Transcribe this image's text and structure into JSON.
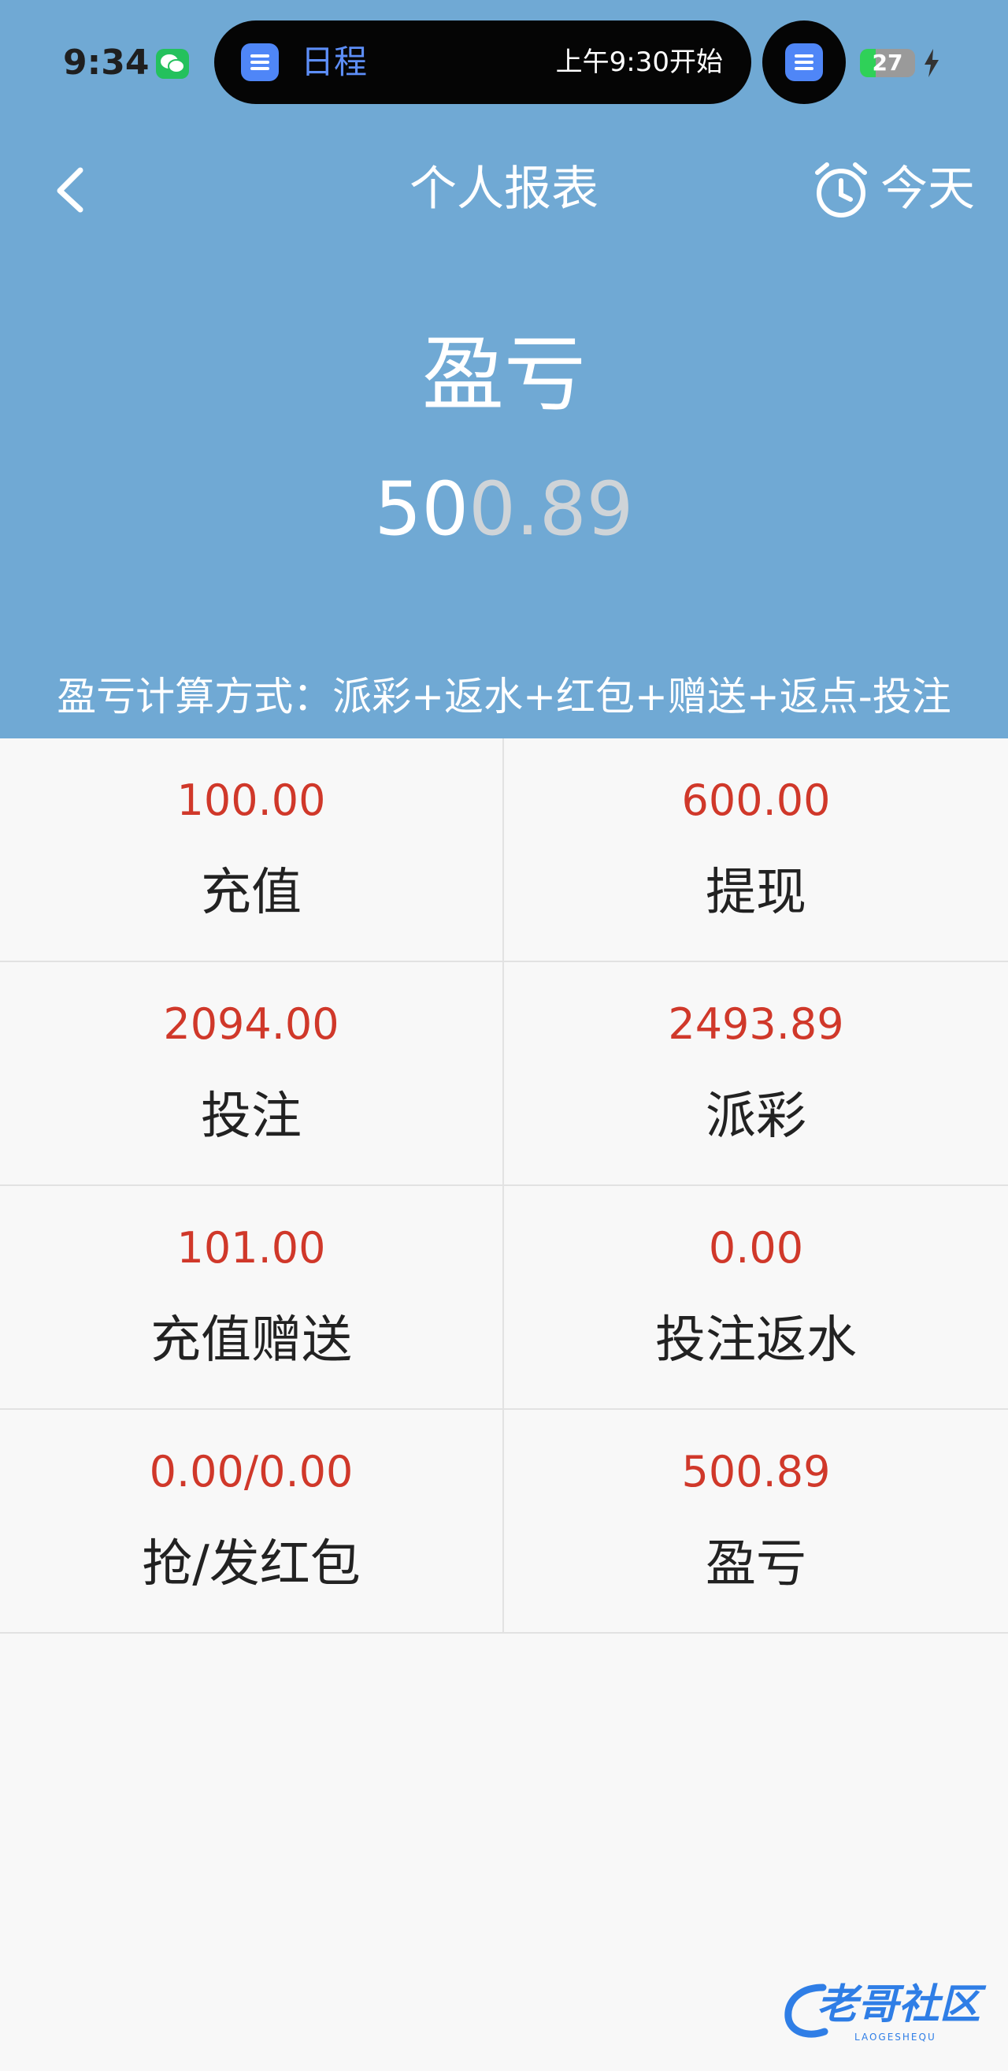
{
  "status_bar": {
    "time": "9:34",
    "island_title": "日程",
    "island_subtitle": "上午9:30开始",
    "battery_level": "27"
  },
  "nav": {
    "title": "个人报表",
    "today_label": "今天"
  },
  "hero": {
    "title": "盈亏",
    "value_main": "50",
    "value_faded": "0.89"
  },
  "formula": "盈亏计算方式：派彩+返水+红包+赠送+返点-投注",
  "stats": [
    {
      "value": "100.00",
      "label": "充值"
    },
    {
      "value": "600.00",
      "label": "提现"
    },
    {
      "value": "2094.00",
      "label": "投注"
    },
    {
      "value": "2493.89",
      "label": "派彩"
    },
    {
      "value": "101.00",
      "label": "充值赠送"
    },
    {
      "value": "0.00",
      "label": "投注返水"
    },
    {
      "value": "0.00/0.00",
      "label": "抢/发红包"
    },
    {
      "value": "500.89",
      "label": "盈亏"
    }
  ],
  "watermark": {
    "text": "老哥社区",
    "sub": "LAOGESHEQU"
  },
  "colors": {
    "header_bg": "#70a9d4",
    "value_red": "#d0382a",
    "page_bg": "#f8f8f8"
  }
}
